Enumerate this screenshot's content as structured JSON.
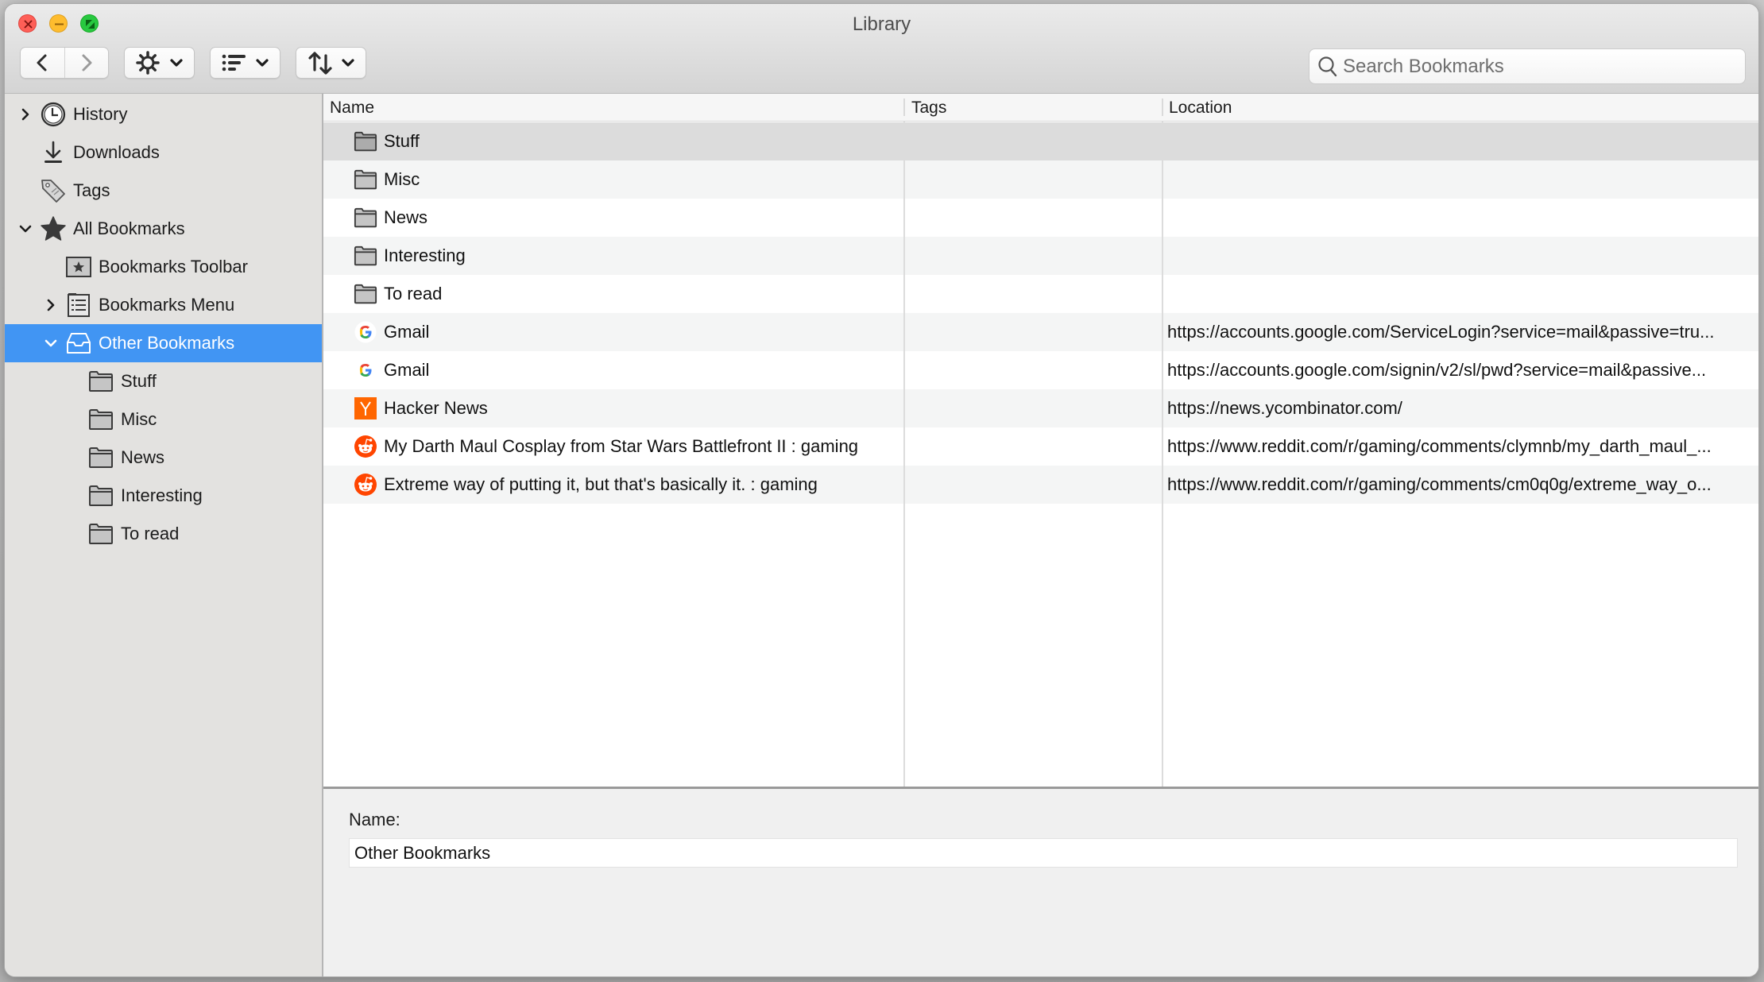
{
  "window": {
    "title": "Library"
  },
  "toolbar": {
    "back_icon": "chevron-left-icon",
    "forward_icon": "chevron-right-icon",
    "organize_icon": "gear-icon",
    "views_icon": "list-view-icon",
    "import_icon": "import-export-icon",
    "search": {
      "placeholder": "Search Bookmarks",
      "value": ""
    }
  },
  "sidebar": {
    "items": [
      {
        "label": "History",
        "icon": "clock-icon",
        "twisty": "collapsed",
        "level": 0
      },
      {
        "label": "Downloads",
        "icon": "download-icon",
        "twisty": "none",
        "level": 0
      },
      {
        "label": "Tags",
        "icon": "tag-icon",
        "twisty": "none",
        "level": 0
      },
      {
        "label": "All Bookmarks",
        "icon": "star-icon",
        "twisty": "expanded",
        "level": 0
      },
      {
        "label": "Bookmarks Toolbar",
        "icon": "bookmarks-toolbar-icon",
        "twisty": "none",
        "level": 1
      },
      {
        "label": "Bookmarks Menu",
        "icon": "bookmarks-menu-icon",
        "twisty": "collapsed",
        "level": 1
      },
      {
        "label": "Other Bookmarks",
        "icon": "inbox-tray-icon",
        "twisty": "expanded",
        "level": 1,
        "selected": true
      },
      {
        "label": "Stuff",
        "icon": "folder-icon",
        "twisty": "none",
        "level": 2
      },
      {
        "label": "Misc",
        "icon": "folder-icon",
        "twisty": "none",
        "level": 2
      },
      {
        "label": "News",
        "icon": "folder-icon",
        "twisty": "none",
        "level": 2
      },
      {
        "label": "Interesting",
        "icon": "folder-icon",
        "twisty": "none",
        "level": 2
      },
      {
        "label": "To read",
        "icon": "folder-icon",
        "twisty": "none",
        "level": 2
      }
    ]
  },
  "table": {
    "columns": [
      "Name",
      "Tags",
      "Location"
    ],
    "rows": [
      {
        "name": "Stuff",
        "icon": "folder-icon",
        "tags": "",
        "location": "",
        "selected": true
      },
      {
        "name": "Misc",
        "icon": "folder-icon",
        "tags": "",
        "location": ""
      },
      {
        "name": "News",
        "icon": "folder-icon",
        "tags": "",
        "location": ""
      },
      {
        "name": "Interesting",
        "icon": "folder-icon",
        "tags": "",
        "location": ""
      },
      {
        "name": "To read",
        "icon": "folder-icon",
        "tags": "",
        "location": ""
      },
      {
        "name": "Gmail",
        "icon": "google-icon",
        "tags": "",
        "location": "https://accounts.google.com/ServiceLogin?service=mail&passive=tru..."
      },
      {
        "name": "Gmail",
        "icon": "google-icon",
        "tags": "",
        "location": "https://accounts.google.com/signin/v2/sl/pwd?service=mail&passive..."
      },
      {
        "name": "Hacker News",
        "icon": "hacker-news-icon",
        "tags": "",
        "location": "https://news.ycombinator.com/"
      },
      {
        "name": "My Darth Maul Cosplay from Star Wars Battlefront II : gaming",
        "icon": "reddit-icon",
        "tags": "",
        "location": "https://www.reddit.com/r/gaming/comments/clymnb/my_darth_maul_..."
      },
      {
        "name": "Extreme way of putting it, but that's basically it. : gaming",
        "icon": "reddit-icon",
        "tags": "",
        "location": "https://www.reddit.com/r/gaming/comments/cm0q0g/extreme_way_o..."
      }
    ]
  },
  "detail": {
    "name_label": "Name:",
    "name_value": "Other Bookmarks"
  },
  "colors": {
    "selection": "#4195f3",
    "sidebar_bg": "#e3e2e0",
    "hn_orange": "#ff6600",
    "reddit_orange": "#ff4500"
  }
}
